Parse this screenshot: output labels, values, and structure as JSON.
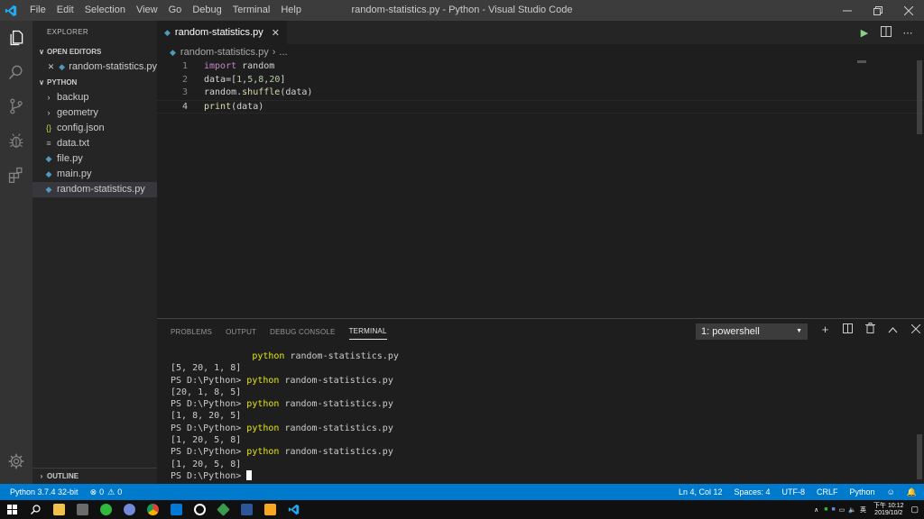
{
  "window": {
    "title": "random-statistics.py - Python - Visual Studio Code"
  },
  "menu": [
    "File",
    "Edit",
    "Selection",
    "View",
    "Go",
    "Debug",
    "Terminal",
    "Help"
  ],
  "sidebar": {
    "title": "EXPLORER",
    "open_editors_label": "OPEN EDITORS",
    "open_editors": [
      {
        "name": "random-statistics.py"
      }
    ],
    "folder_label": "PYTHON",
    "items": [
      {
        "name": "backup",
        "kind": "folder"
      },
      {
        "name": "geometry",
        "kind": "folder"
      },
      {
        "name": "config.json",
        "kind": "json"
      },
      {
        "name": "data.txt",
        "kind": "text"
      },
      {
        "name": "file.py",
        "kind": "python"
      },
      {
        "name": "main.py",
        "kind": "python"
      },
      {
        "name": "random-statistics.py",
        "kind": "python",
        "selected": true
      }
    ],
    "outline_label": "OUTLINE"
  },
  "editor": {
    "tab_label": "random-statistics.py",
    "breadcrumb_file": "random-statistics.py",
    "breadcrumb_more": "...",
    "lines": [
      {
        "n": "1",
        "text": "import random"
      },
      {
        "n": "2",
        "text": "data=[1,5,8,20]"
      },
      {
        "n": "3",
        "text": "random.shuffle(data)"
      },
      {
        "n": "4",
        "text": "print(data)"
      }
    ]
  },
  "panel": {
    "tabs": [
      "PROBLEMS",
      "OUTPUT",
      "DEBUG CONSOLE",
      "TERMINAL"
    ],
    "active_tab": "TERMINAL",
    "terminal_select": "1: powershell",
    "terminal_lines": [
      {
        "prompt": "               ",
        "cmd": "python",
        "rest": " random-statistics.py"
      },
      {
        "prompt": "[5, 20, 1, 8]",
        "cmd": "",
        "rest": ""
      },
      {
        "prompt": "PS D:\\Python> ",
        "cmd": "python",
        "rest": " random-statistics.py"
      },
      {
        "prompt": "[20, 1, 8, 5]",
        "cmd": "",
        "rest": ""
      },
      {
        "prompt": "PS D:\\Python> ",
        "cmd": "python",
        "rest": " random-statistics.py"
      },
      {
        "prompt": "[1, 8, 20, 5]",
        "cmd": "",
        "rest": ""
      },
      {
        "prompt": "PS D:\\Python> ",
        "cmd": "python",
        "rest": " random-statistics.py"
      },
      {
        "prompt": "[1, 20, 5, 8]",
        "cmd": "",
        "rest": ""
      },
      {
        "prompt": "PS D:\\Python> ",
        "cmd": "python",
        "rest": " random-statistics.py"
      },
      {
        "prompt": "[1, 20, 5, 8]",
        "cmd": "",
        "rest": ""
      }
    ],
    "last_prompt": "PS D:\\Python> "
  },
  "status": {
    "interpreter": "Python 3.7.4 32-bit",
    "errors": "0",
    "warnings": "0",
    "position": "Ln 4, Col 12",
    "spaces": "Spaces: 4",
    "encoding": "UTF-8",
    "eol": "CRLF",
    "language": "Python"
  },
  "taskbar": {
    "time": "下午 10:12",
    "date": "2019/10/2",
    "ime": "英"
  },
  "colors": {
    "statusbar": "#007acc",
    "keyword": "#c586c0",
    "function": "#dcdcaa",
    "number": "#b5cea8",
    "terminal_cmd": "#e5e510"
  }
}
